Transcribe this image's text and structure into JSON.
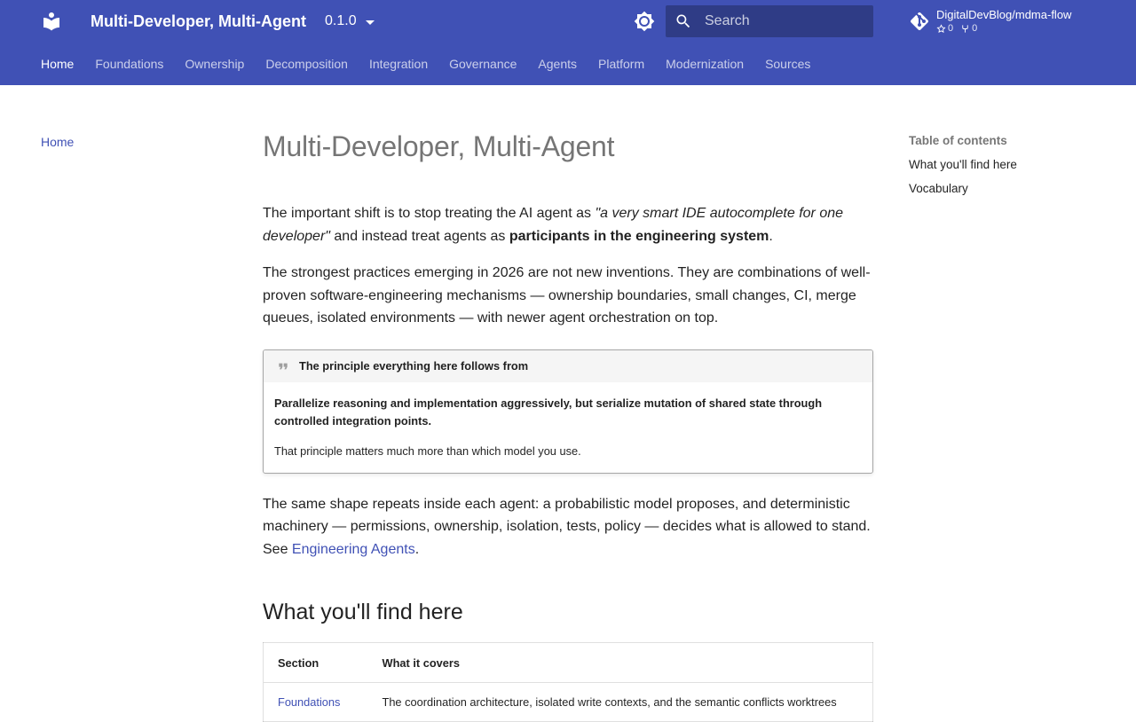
{
  "header": {
    "site_title": "Multi-Developer, Multi-Agent",
    "version": "0.1.0",
    "search_placeholder": "Search",
    "repo": {
      "name": "DigitalDevBlog/mdma-flow",
      "stars": "0",
      "forks": "0"
    },
    "icons": [
      "logo-icon",
      "theme-toggle-icon",
      "search-icon",
      "git-icon",
      "star-icon",
      "fork-icon"
    ]
  },
  "tabs": [
    {
      "label": "Home",
      "active": true
    },
    {
      "label": "Foundations"
    },
    {
      "label": "Ownership"
    },
    {
      "label": "Decomposition"
    },
    {
      "label": "Integration"
    },
    {
      "label": "Governance"
    },
    {
      "label": "Agents"
    },
    {
      "label": "Platform"
    },
    {
      "label": "Modernization"
    },
    {
      "label": "Sources"
    }
  ],
  "sidebar": {
    "items": [
      {
        "label": "Home"
      }
    ]
  },
  "toc": {
    "title": "Table of contents",
    "items": [
      {
        "label": "What you'll find here"
      },
      {
        "label": "Vocabulary"
      }
    ]
  },
  "main": {
    "title": "Multi-Developer, Multi-Agent",
    "p1": {
      "pre": "The important shift is to stop treating the AI agent as ",
      "quote": "\"a very smart IDE autocomplete for one developer\"",
      "mid": " and instead treat agents as ",
      "strong": "participants in the engineering system",
      "post": "."
    },
    "p2": "The strongest practices emerging in 2026 are not new inventions. They are combinations of well-proven software-engineering mechanisms — ownership boundaries, small changes, CI, merge queues, isolated environments — with newer agent orchestration on top.",
    "admonition": {
      "title": "The principle everything here follows from",
      "strong": "Parallelize reasoning and implementation aggressively, but serialize mutation of shared state through controlled integration points.",
      "text": "That principle matters much more than which model you use."
    },
    "p3": {
      "pre": "The same shape repeats inside each agent: a probabilistic model proposes, and deterministic machinery — permissions, ownership, isolation, tests, policy — decides what is allowed to stand. See ",
      "link": "Engineering Agents",
      "post": "."
    },
    "h2": "What you'll find here",
    "table": {
      "headers": [
        "Section",
        "What it covers"
      ],
      "rows": [
        {
          "section": "Foundations",
          "covers": "The coordination architecture, isolated write contexts, and the semantic conflicts worktrees"
        }
      ]
    }
  },
  "colors": {
    "primary": "#4051b5",
    "link": "#4051b5",
    "text": "#212121"
  }
}
